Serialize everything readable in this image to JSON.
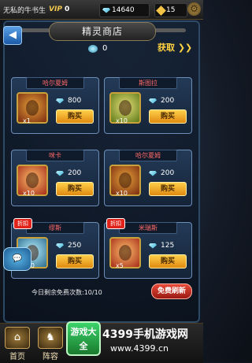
{
  "topbar": {
    "player_name": "无私的牛书生",
    "vip_label": "VIP",
    "vip_level": "0",
    "diamonds": "14640",
    "gold": "15"
  },
  "header": {
    "title": "精灵商店",
    "obtain_label": "获取"
  },
  "spirit_count": "0",
  "items": [
    {
      "name": "哈尔夏姆",
      "price": "800",
      "qty": "x1",
      "buy_label": "购买",
      "badge": ""
    },
    {
      "name": "斯图拉",
      "price": "200",
      "qty": "x10",
      "buy_label": "购买",
      "badge": ""
    },
    {
      "name": "咪卡",
      "price": "200",
      "qty": "x10",
      "buy_label": "购买",
      "badge": ""
    },
    {
      "name": "哈尔夏姆",
      "price": "200",
      "qty": "x10",
      "buy_label": "购买",
      "badge": ""
    },
    {
      "name": "缪斯",
      "price": "250",
      "qty": "x10",
      "buy_label": "购买",
      "badge": "折扣"
    },
    {
      "name": "米瑞斯",
      "price": "125",
      "qty": "x5",
      "buy_label": "购买",
      "badge": "折扣"
    }
  ],
  "footer": {
    "free_refresh_text": "今日剩余免费次数:10/10",
    "refresh_label": "免费刷新"
  },
  "bottom_nav": {
    "home_label": "首页",
    "team_label": "阵容"
  },
  "watermark": {
    "logo_text": "游戏大全",
    "site_title": "4399手机游戏网",
    "site_url": "www.4399.cn"
  }
}
